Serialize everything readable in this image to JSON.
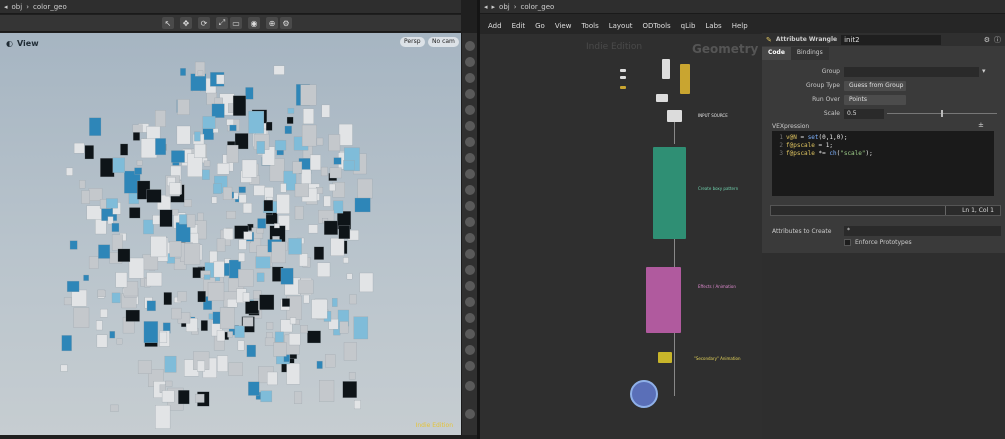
{
  "left_pane": {
    "path": {
      "context": "obj",
      "node": "color_geo"
    },
    "view_label": "View",
    "persp_chip": "Persp",
    "cam_chip": "No cam",
    "indie_mark": "Indie Edition"
  },
  "right_pane": {
    "path": {
      "context": "obj",
      "node": "color_geo"
    },
    "menu": [
      "Add",
      "Edit",
      "Go",
      "View",
      "Tools",
      "Layout",
      "ODTools",
      "qLib",
      "Labs",
      "Help"
    ],
    "network": {
      "watermark": "Indie Edition",
      "watermark_geo": "Geometry",
      "notes": {
        "input_source": "INPUT SOURCE",
        "create_boxes": "Create boxy pattern",
        "effects": "Effects / Animation",
        "secondary": "\"Secondary\" Animation"
      },
      "colors": {
        "green_box": "#2f8f74",
        "pink_box": "#b05a9e",
        "yellow_node": "#c8b52a",
        "out_node": "#5a6fb8"
      }
    },
    "params": {
      "node_type": "Attribute Wrangle",
      "node_name": "init2",
      "tabs": [
        "Code",
        "Bindings"
      ],
      "active_tab": "Code",
      "group_label": "Group",
      "group_value": "",
      "group_type_label": "Group Type",
      "group_type_value": "Guess from Group",
      "run_over_label": "Run Over",
      "run_over_value": "Points",
      "scale_label": "Scale",
      "scale_value": "0.5",
      "scale_fraction": 0.5,
      "vex_label": "VEXpression",
      "code": [
        {
          "n": "1",
          "parts": [
            [
              "y",
              "v@N"
            ],
            [
              "w",
              " = "
            ],
            [
              "b",
              "set"
            ],
            [
              "w",
              "(0,1,0);"
            ]
          ]
        },
        {
          "n": "2",
          "parts": [
            [
              "y",
              "f@pscale"
            ],
            [
              "w",
              " = 1;"
            ]
          ]
        },
        {
          "n": "3",
          "parts": [
            [
              "y",
              "f@pscale"
            ],
            [
              "w",
              " *= "
            ],
            [
              "b",
              "ch"
            ],
            [
              "w",
              "("
            ],
            [
              "s",
              "\"scale\""
            ],
            [
              "w",
              ");"
            ]
          ]
        }
      ],
      "cursor_pos": "Ln 1, Col 1",
      "attrs_label": "Attributes to Create",
      "attrs_value": "*",
      "enforce_label": "Enforce Prototypes"
    }
  }
}
